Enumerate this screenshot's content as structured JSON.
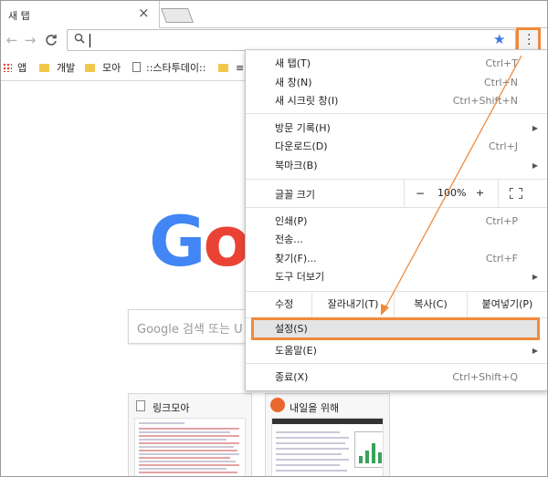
{
  "tab": {
    "title": "새 탭",
    "close_icon": "close-icon"
  },
  "toolbar": {
    "back_icon": "arrow-left-icon",
    "forward_icon": "arrow-right-icon",
    "reload_icon": "reload-icon",
    "omnibox_value": "",
    "bookmark_icon": "star-icon",
    "star_color": "#3b78e7",
    "menu_icon": "vertical-dots-icon"
  },
  "bookmarks": [
    {
      "label": "앱",
      "icon": "apps-grid-icon"
    },
    {
      "label": "개발",
      "icon": "folder-icon"
    },
    {
      "label": "모아",
      "icon": "folder-icon"
    },
    {
      "label": "::스타투데이::",
      "icon": "page-icon"
    },
    {
      "label": "≡ ",
      "icon": "folder-icon"
    }
  ],
  "google": {
    "logo_text": "Go",
    "search_placeholder": "Google 검색 또는 U"
  },
  "tiles": [
    {
      "title": "링크모아",
      "icon": "page-icon"
    },
    {
      "title": "내일을 위해",
      "icon": "site-favicon"
    }
  ],
  "menu": {
    "new_tab": {
      "label": "새 탭(T)",
      "shortcut": "Ctrl+T"
    },
    "new_window": {
      "label": "새 창(N)",
      "shortcut": "Ctrl+N"
    },
    "incognito": {
      "label": "새 시크릿 창(I)",
      "shortcut": "Ctrl+Shift+N"
    },
    "history": {
      "label": "방문 기록(H)"
    },
    "downloads": {
      "label": "다운로드(D)",
      "shortcut": "Ctrl+J"
    },
    "bookmarks": {
      "label": "북마크(B)"
    },
    "zoom": {
      "label": "글꼴 크기",
      "minus": "−",
      "value": "100%",
      "plus": "+"
    },
    "print": {
      "label": "인쇄(P)",
      "shortcut": "Ctrl+P"
    },
    "cast": {
      "label": "전송..."
    },
    "find": {
      "label": "찾기(F)...",
      "shortcut": "Ctrl+F"
    },
    "more_tools": {
      "label": "도구 더보기"
    },
    "edit": {
      "label": "수정",
      "cut": "잘라내기(T)",
      "copy": "복사(C)",
      "paste": "붙여넣기(P)"
    },
    "settings": {
      "label": "설정(S)"
    },
    "help": {
      "label": "도움말(E)"
    },
    "exit": {
      "label": "종료(X)",
      "shortcut": "Ctrl+Shift+Q"
    }
  },
  "colors": {
    "highlight": "#ef8a3d",
    "google_blue": "#4285f4",
    "google_red": "#ea4335"
  }
}
